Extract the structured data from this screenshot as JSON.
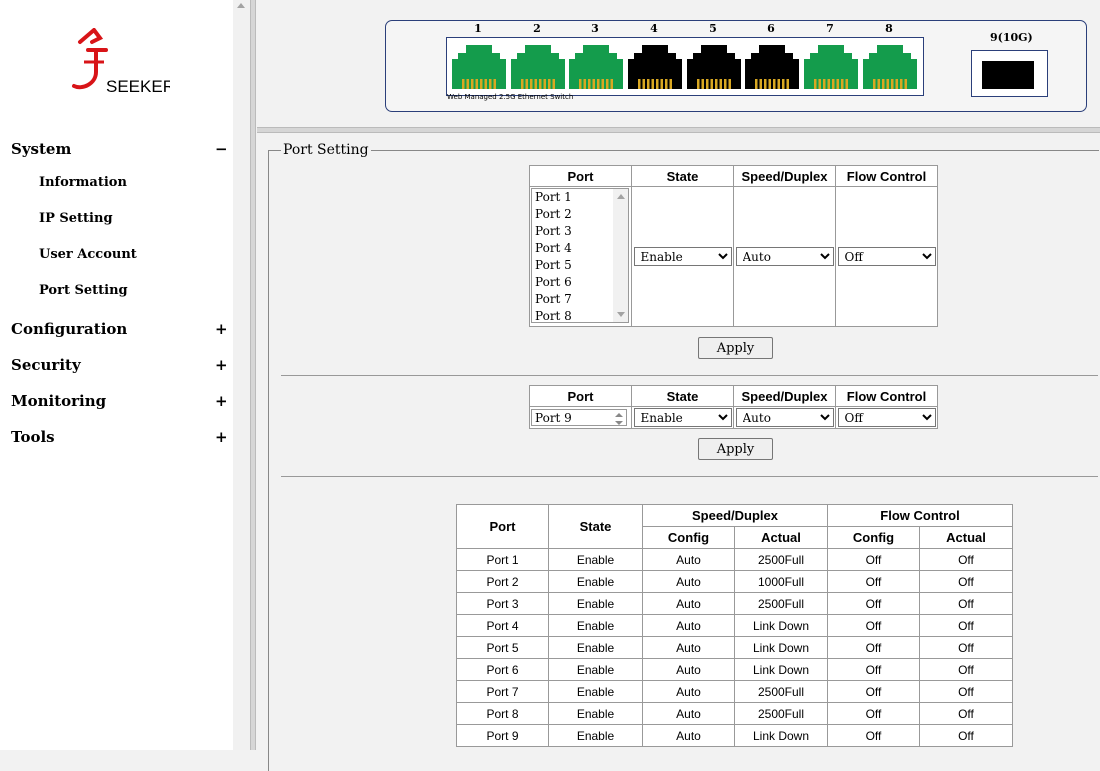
{
  "sidebar": {
    "logo_text": "SEEKER",
    "menu": [
      {
        "label": "System",
        "sign": "−",
        "children": [
          "Information",
          "IP Setting",
          "User Account",
          "Port Setting"
        ]
      },
      {
        "label": "Configuration",
        "sign": "+"
      },
      {
        "label": "Security",
        "sign": "+"
      },
      {
        "label": "Monitoring",
        "sign": "+"
      },
      {
        "label": "Tools",
        "sign": "+"
      }
    ]
  },
  "header": {
    "port_numbers": [
      "1",
      "2",
      "3",
      "4",
      "5",
      "6",
      "7",
      "8"
    ],
    "port_states": [
      "up",
      "up",
      "up",
      "down",
      "down",
      "down",
      "up",
      "up"
    ],
    "switch_label": "Web Managed 2.5G Ethernet Switch",
    "port9_label": "9(10G)",
    "colors": {
      "up": "#149c4c",
      "down": "#000000",
      "border": "#2b3f7a"
    }
  },
  "port_setting": {
    "legend": "Port Setting",
    "headers": [
      "Port",
      "State",
      "Speed/Duplex",
      "Flow Control"
    ],
    "port_list": [
      "Port 1",
      "Port 2",
      "Port 3",
      "Port 4",
      "Port 5",
      "Port 6",
      "Port 7",
      "Port 8"
    ],
    "state_value": "Enable",
    "speed_value": "Auto",
    "flow_value": "Off",
    "apply_label": "Apply",
    "port9_value": "Port 9"
  },
  "status_table": {
    "header_top": [
      "Port",
      "State",
      "Speed/Duplex",
      "Flow Control"
    ],
    "header_sub": [
      "Config",
      "Actual",
      "Config",
      "Actual"
    ],
    "rows": [
      [
        "Port 1",
        "Enable",
        "Auto",
        "2500Full",
        "Off",
        "Off"
      ],
      [
        "Port 2",
        "Enable",
        "Auto",
        "1000Full",
        "Off",
        "Off"
      ],
      [
        "Port 3",
        "Enable",
        "Auto",
        "2500Full",
        "Off",
        "Off"
      ],
      [
        "Port 4",
        "Enable",
        "Auto",
        "Link Down",
        "Off",
        "Off"
      ],
      [
        "Port 5",
        "Enable",
        "Auto",
        "Link Down",
        "Off",
        "Off"
      ],
      [
        "Port 6",
        "Enable",
        "Auto",
        "Link Down",
        "Off",
        "Off"
      ],
      [
        "Port 7",
        "Enable",
        "Auto",
        "2500Full",
        "Off",
        "Off"
      ],
      [
        "Port 8",
        "Enable",
        "Auto",
        "2500Full",
        "Off",
        "Off"
      ],
      [
        "Port 9",
        "Enable",
        "Auto",
        "Link Down",
        "Off",
        "Off"
      ]
    ]
  }
}
